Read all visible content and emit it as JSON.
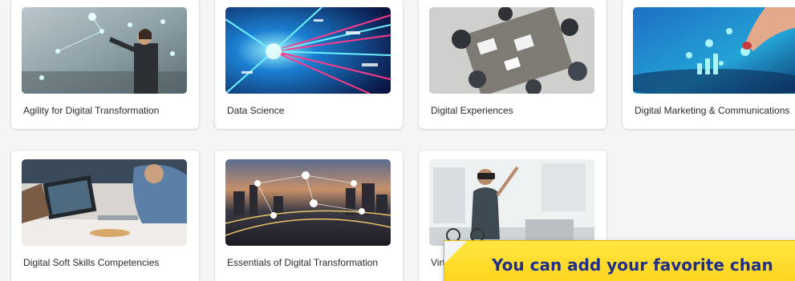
{
  "channels": [
    {
      "title": "Agility for Digital Transformation",
      "image": "woman-touching-holographic-interface"
    },
    {
      "title": "Data Science",
      "image": "data-streams-light-tunnel"
    },
    {
      "title": "Digital Experiences",
      "image": "team-at-office-table-overhead"
    },
    {
      "title": "Digital Marketing & Communications",
      "image": "hand-on-tablet-with-icons"
    },
    {
      "title": "Digital Soft Skills Competencies",
      "image": "people-working-on-laptops"
    },
    {
      "title": "Essentials of Digital Transformation",
      "image": "city-network-at-dusk"
    },
    {
      "title": "Virtual Reality",
      "image": "woman-with-vr-headset"
    }
  ],
  "tooltip": {
    "text": "You can add your favorite chan"
  }
}
